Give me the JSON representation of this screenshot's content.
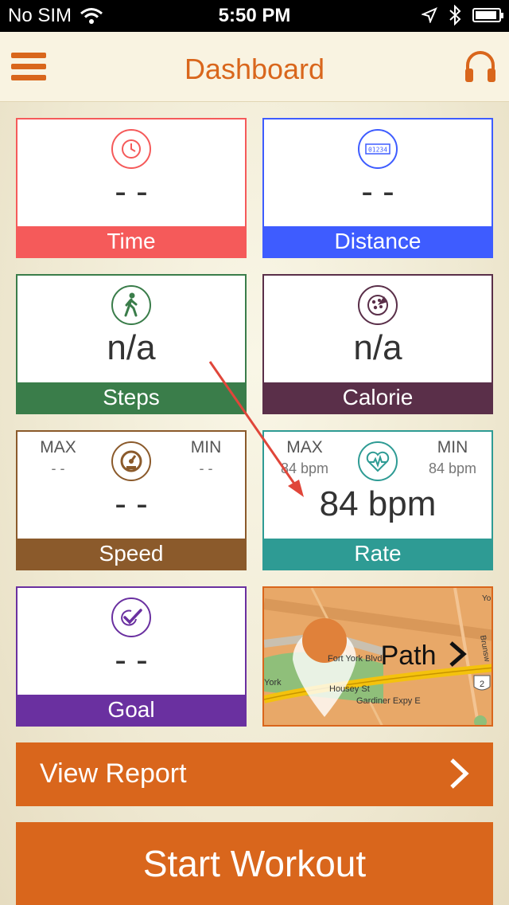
{
  "status_bar": {
    "carrier": "No SIM",
    "time": "5:50 PM",
    "icons": [
      "wifi-icon",
      "location-icon",
      "bluetooth-icon",
      "battery-icon"
    ]
  },
  "nav": {
    "title": "Dashboard",
    "menu_icon": "menu-icon",
    "audio_icon": "headphones-icon"
  },
  "tiles": {
    "time": {
      "value": "- -",
      "label": "Time",
      "icon": "clock-icon",
      "color": "#f55a5a"
    },
    "distance": {
      "value": "- -",
      "label": "Distance",
      "icon": "odometer-icon",
      "color": "#3e5cff"
    },
    "steps": {
      "value": "n/a",
      "label": "Steps",
      "icon": "walking-icon",
      "color": "#3a7d4a"
    },
    "calorie": {
      "value": "n/a",
      "label": "Calorie",
      "icon": "pizza-icon",
      "color": "#5a2f49"
    },
    "speed": {
      "value": "- -",
      "label": "Speed",
      "icon": "speedometer-icon",
      "color": "#8b5a2b",
      "max_label": "MAX",
      "max_value": "- -",
      "min_label": "MIN",
      "min_value": "- -"
    },
    "rate": {
      "value": "84 bpm",
      "label": "Rate",
      "icon": "heart-rate-icon",
      "color": "#2e9b94",
      "max_label": "MAX",
      "max_value": "84 bpm",
      "min_label": "MIN",
      "min_value": "84 bpm"
    },
    "goal": {
      "value": "- -",
      "label": "Goal",
      "icon": "check-icon",
      "color": "#6a30a0"
    }
  },
  "map": {
    "path_label": "Path",
    "street_labels": [
      "Fort York Blvd",
      "Housey St",
      "Gardiner Expy E",
      "York",
      "Brunsw",
      "Yo"
    ],
    "shield_number": "2"
  },
  "buttons": {
    "view_report": "View Report",
    "start_workout": "Start Workout"
  },
  "colors": {
    "accent": "#d9661c",
    "annotation_arrow": "#e0463a"
  }
}
